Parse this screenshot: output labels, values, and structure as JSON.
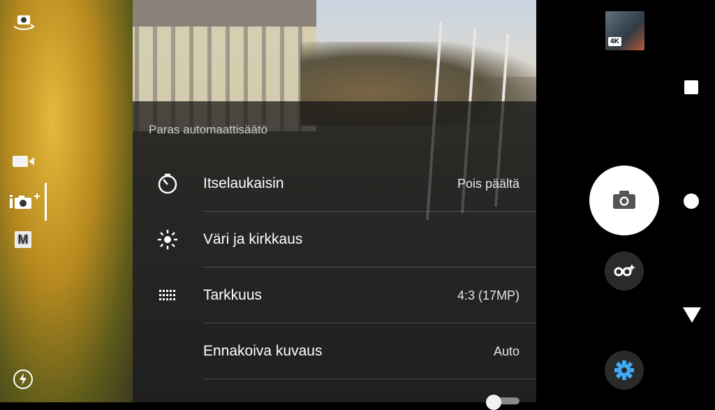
{
  "menu": {
    "title": "Paras automaattisäätö",
    "items": [
      {
        "label": "Itselaukaisin",
        "value": "Pois päältä",
        "icon": "self-timer-icon"
      },
      {
        "label": "Väri ja kirkkaus",
        "value": "",
        "icon": "brightness-icon"
      },
      {
        "label": "Tarkkuus",
        "value": "4:3 (17MP)",
        "icon": "resolution-grid-icon"
      },
      {
        "label": "Ennakoiva kuvaus",
        "value": "Auto",
        "icon": ""
      }
    ]
  },
  "left_modes": {
    "manual_label": "M"
  },
  "right_panel": {
    "thumbnail_badge": "4K",
    "accent_color": "#3fa9f5"
  }
}
